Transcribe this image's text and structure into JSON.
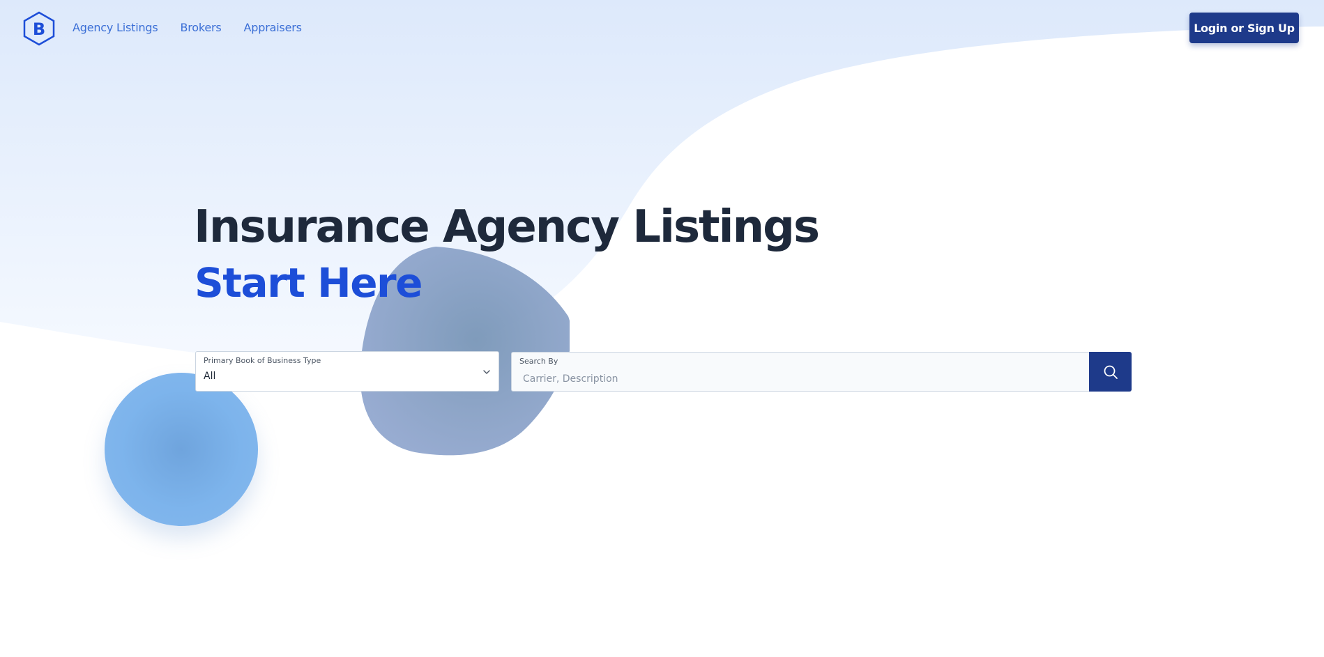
{
  "brand": {
    "logo_letter": "B",
    "logo_color": "#1d4ed8"
  },
  "nav": {
    "items": [
      {
        "label": "Agency Listings"
      },
      {
        "label": "Brokers"
      },
      {
        "label": "Appraisers"
      }
    ],
    "link_color": "#3b6fd6"
  },
  "auth": {
    "login_label": "Login or Sign Up",
    "button_color": "#1e3a8a"
  },
  "hero": {
    "title": "Insurance Agency Listings",
    "subtitle": "Start Here",
    "title_color": "#1e293b",
    "subtitle_color": "#1d4ed8"
  },
  "filters": {
    "book_type": {
      "label": "Primary Book of Business Type",
      "value": "All"
    },
    "search": {
      "label": "Search By",
      "placeholder": "Carrier, Description",
      "value": ""
    }
  },
  "icons": {
    "search": "search-icon",
    "chevron": "chevron-down-icon",
    "logo": "hexagon-b-logo"
  }
}
